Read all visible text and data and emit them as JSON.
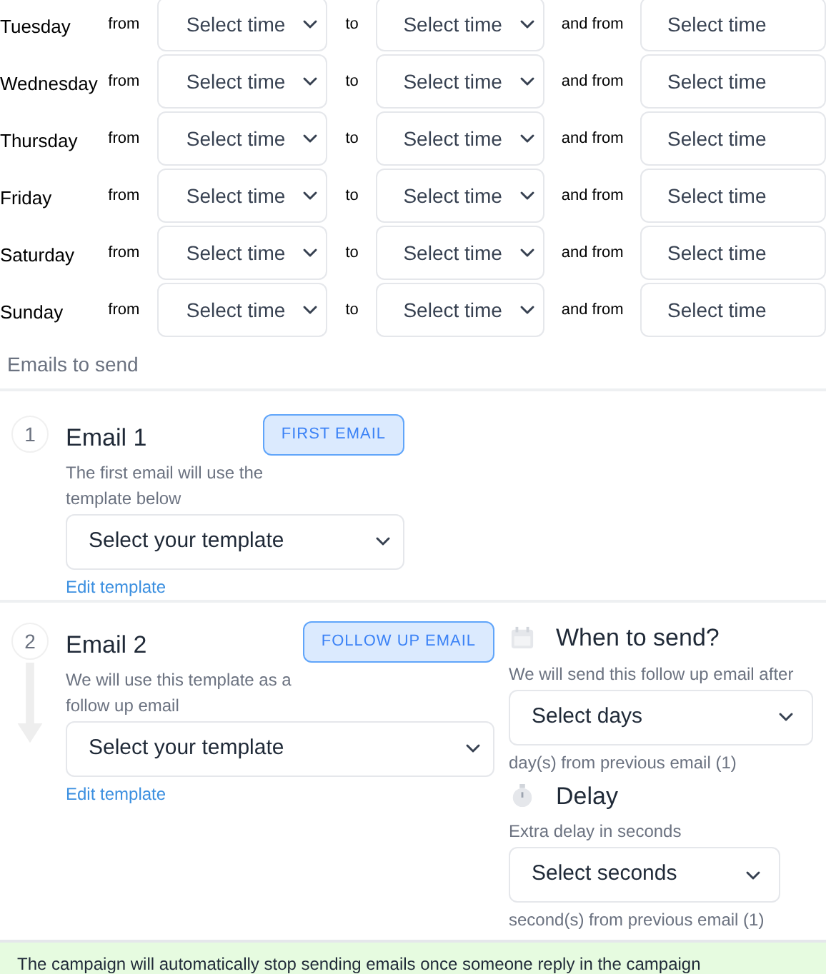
{
  "schedule": [
    {
      "day": "Tuesday",
      "from_label": "from",
      "from": {
        "value": "Select time"
      },
      "to_label": "to",
      "to": {
        "value": "Select time"
      },
      "and_from_label": "and from",
      "and_from": {
        "value": "Select time"
      }
    },
    {
      "day": "Wednesday",
      "from_label": "from",
      "from": {
        "value": "Select time"
      },
      "to_label": "to",
      "to": {
        "value": "Select time"
      },
      "and_from_label": "and from",
      "and_from": {
        "value": "Select time"
      }
    },
    {
      "day": "Thursday",
      "from_label": "from",
      "from": {
        "value": "Select time"
      },
      "to_label": "to",
      "to": {
        "value": "Select time"
      },
      "and_from_label": "and from",
      "and_from": {
        "value": "Select time"
      }
    },
    {
      "day": "Friday",
      "from_label": "from",
      "from": {
        "value": "Select time"
      },
      "to_label": "to",
      "to": {
        "value": "Select time"
      },
      "and_from_label": "and from",
      "and_from": {
        "value": "Select time"
      }
    },
    {
      "day": "Saturday",
      "from_label": "from",
      "from": {
        "value": "Select time"
      },
      "to_label": "to",
      "to": {
        "value": "Select time"
      },
      "and_from_label": "and from",
      "and_from": {
        "value": "Select time"
      }
    },
    {
      "day": "Sunday",
      "from_label": "from",
      "from": {
        "value": "Select time"
      },
      "to_label": "to",
      "to": {
        "value": "Select time"
      },
      "and_from_label": "and from",
      "and_from": {
        "value": "Select time"
      }
    }
  ],
  "emails_heading": "Emails to send",
  "emails": [
    {
      "kind": "first",
      "number": "1",
      "title": "Email 1",
      "badge": "FIRST EMAIL",
      "description": "The first email will use the template below",
      "template_select": {
        "value": "Select your template"
      },
      "edit_link": "Edit template"
    },
    {
      "kind": "follow_up",
      "number": "2",
      "title": "Email 2",
      "badge": "FOLLOW UP EMAIL",
      "description": "We will use this template as a follow up email",
      "template_select": {
        "value": "Select your template"
      },
      "edit_link": "Edit template",
      "when_to_send": {
        "title": "When to send?",
        "description": "We will send this follow up email after",
        "select": {
          "value": "Select days"
        },
        "note": "day(s) from previous email (1)"
      },
      "delay": {
        "title": "Delay",
        "description": "Extra delay in seconds",
        "select": {
          "value": "Select seconds"
        },
        "note": "second(s) from previous email (1)"
      }
    }
  ],
  "banner": {
    "text": "The campaign will automatically stop sending emails once someone reply in the campaign"
  }
}
